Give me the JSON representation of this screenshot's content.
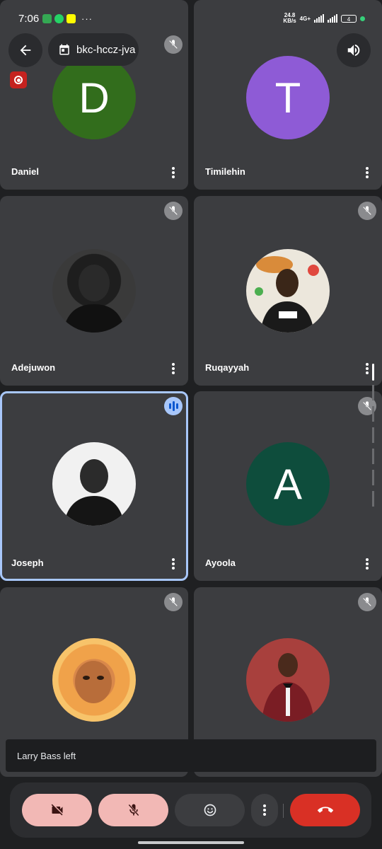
{
  "status_bar": {
    "time": "7:06",
    "more": "···",
    "net_speed_value": "24.8",
    "net_speed_unit": "KB/s",
    "network_type": "4G+",
    "battery": "4"
  },
  "header": {
    "meeting_code": "bkc-hccz-jva"
  },
  "participants": [
    {
      "name": "Daniel",
      "initial": "D",
      "color": "#326d1c",
      "muted": true
    },
    {
      "name": "Timilehin",
      "initial": "T",
      "color": "#8e5bd6",
      "muted": false
    },
    {
      "name": "Adejuwon",
      "initial": "",
      "photo": "portrait-photo",
      "muted": true
    },
    {
      "name": "Ruqayyah",
      "initial": "",
      "photo": "portrait-photo",
      "muted": true
    },
    {
      "name": "Joseph",
      "initial": "",
      "photo": "portrait-photo",
      "speaking": true
    },
    {
      "name": "Ayoola",
      "initial": "A",
      "color": "#0e4d3c",
      "muted": true
    },
    {
      "name": "",
      "initial": "",
      "photo": "portrait-photo",
      "muted": true
    },
    {
      "name": "",
      "initial": "",
      "photo": "portrait-photo",
      "muted": true
    }
  ],
  "toast": {
    "message": "Larry Bass left"
  },
  "colors": {
    "hangup": "#d93025",
    "muted_button": "#f2b8b5",
    "active_border": "#a8c7fa",
    "recording": "#c5221f"
  }
}
